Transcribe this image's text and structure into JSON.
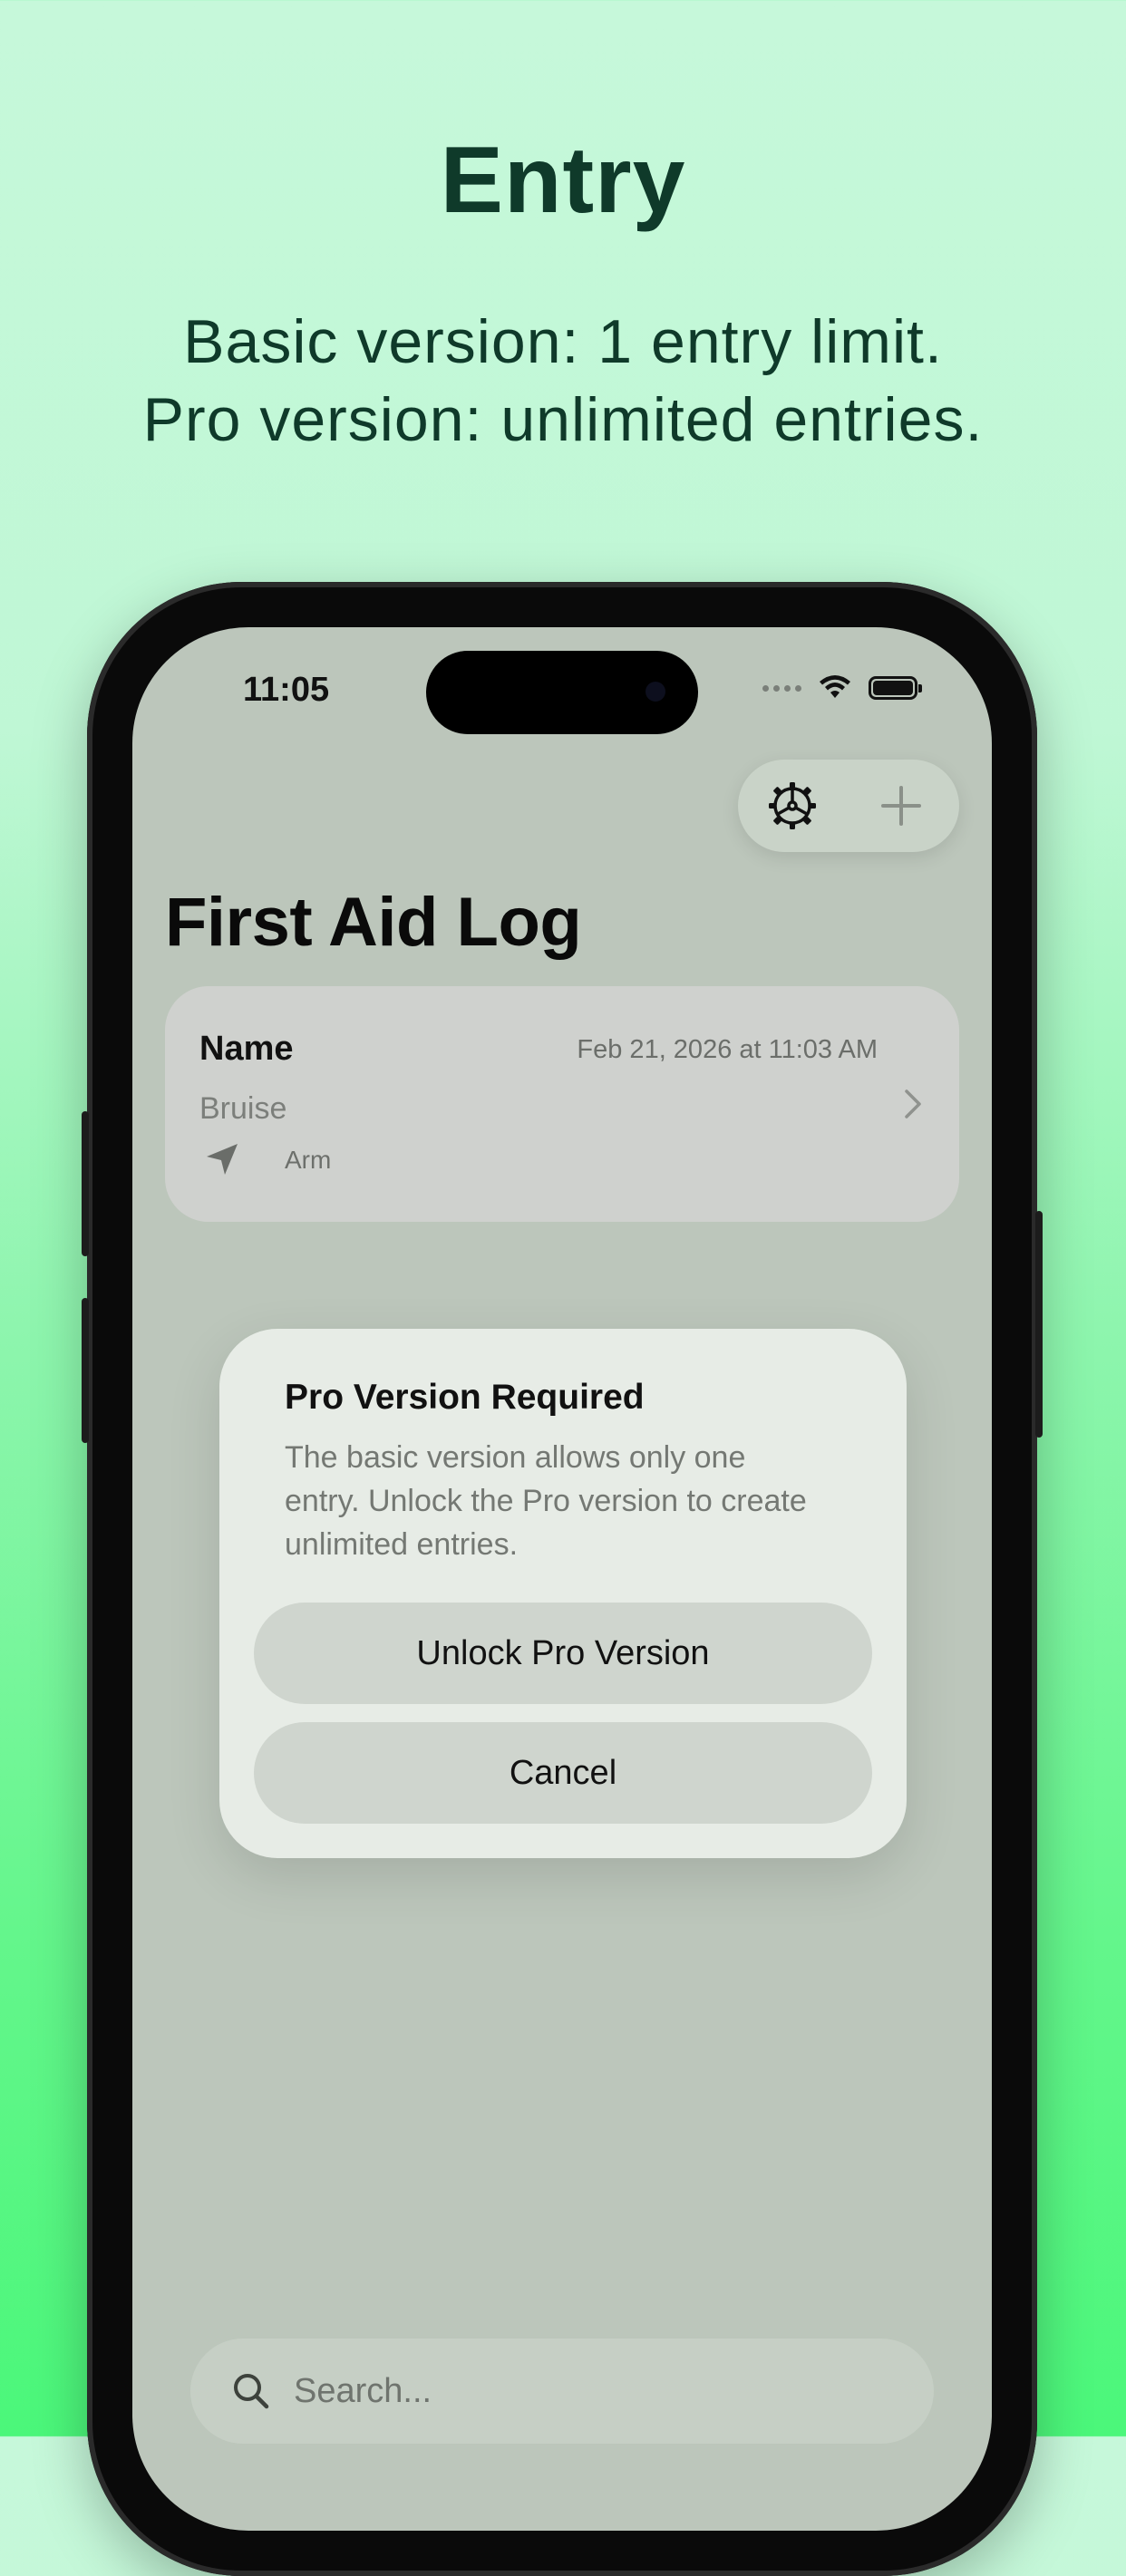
{
  "promo": {
    "title": "Entry",
    "subtitle_line1": "Basic version: 1 entry limit.",
    "subtitle_line2": "Pro version: unlimited entries."
  },
  "status_bar": {
    "time": "11:05"
  },
  "toolbar": {
    "settings_icon": "gear-icon",
    "add_icon": "plus-icon"
  },
  "page": {
    "title": "First Aid Log"
  },
  "entry": {
    "name": "Name",
    "date": "Feb 21, 2026 at 11:03 AM",
    "injury": "Bruise",
    "location": "Arm"
  },
  "alert": {
    "title": "Pro Version Required",
    "message": "The basic version allows only one entry. Unlock the Pro version to create unlimited entries.",
    "primary_label": "Unlock Pro Version",
    "secondary_label": "Cancel"
  },
  "search": {
    "placeholder": "Search..."
  },
  "colors": {
    "headline": "#0f3a2a",
    "screen_bg": "#bcc6bb",
    "alert_bg": "#e7ece6",
    "button_bg": "#cfd5ce"
  }
}
